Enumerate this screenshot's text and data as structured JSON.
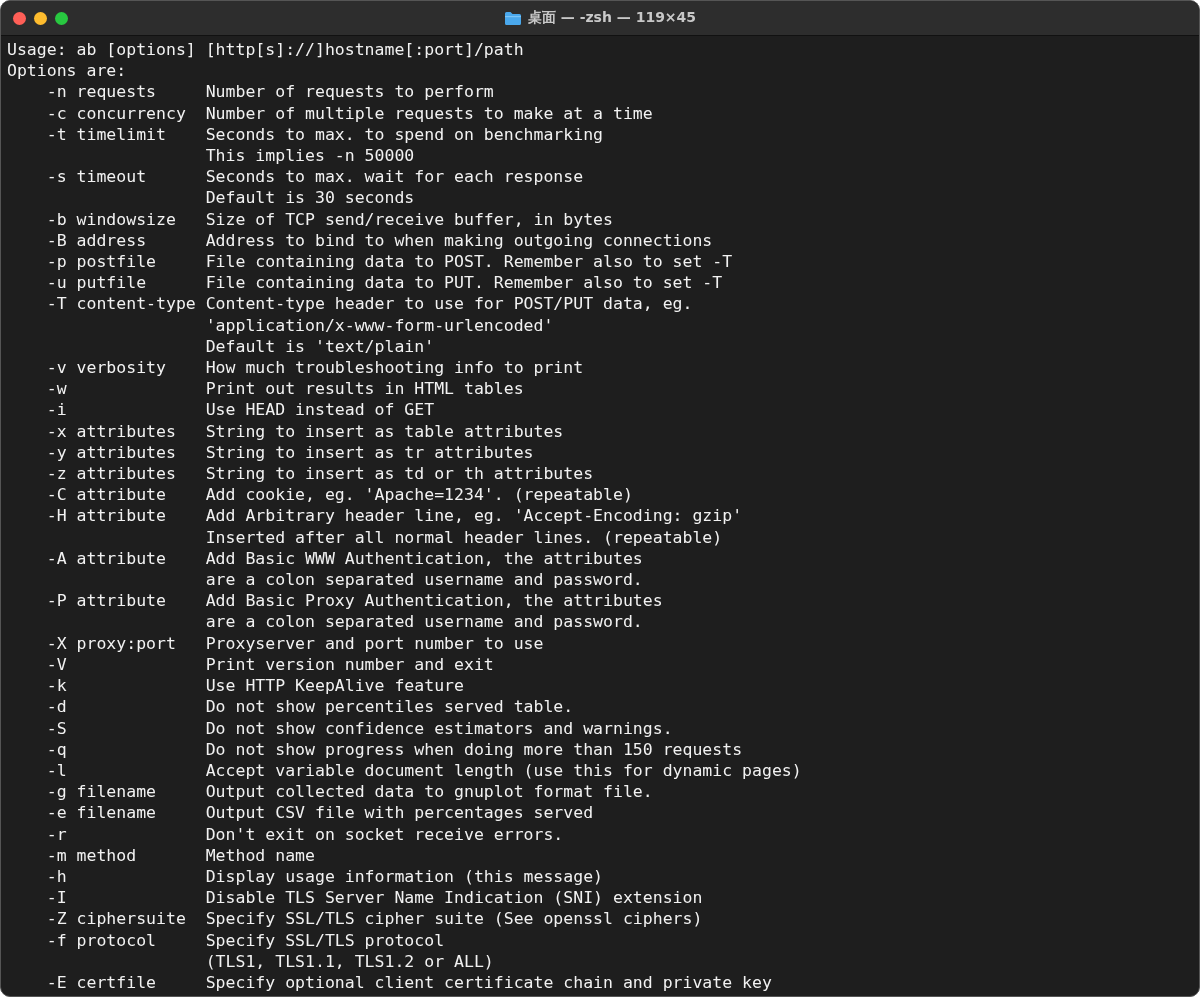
{
  "window": {
    "title": "桌面 — -zsh — 119×45"
  },
  "lines": [
    "Usage: ab [options] [http[s]://]hostname[:port]/path",
    "Options are:",
    "    -n requests     Number of requests to perform",
    "    -c concurrency  Number of multiple requests to make at a time",
    "    -t timelimit    Seconds to max. to spend on benchmarking",
    "                    This implies -n 50000",
    "    -s timeout      Seconds to max. wait for each response",
    "                    Default is 30 seconds",
    "    -b windowsize   Size of TCP send/receive buffer, in bytes",
    "    -B address      Address to bind to when making outgoing connections",
    "    -p postfile     File containing data to POST. Remember also to set -T",
    "    -u putfile      File containing data to PUT. Remember also to set -T",
    "    -T content-type Content-type header to use for POST/PUT data, eg.",
    "                    'application/x-www-form-urlencoded'",
    "                    Default is 'text/plain'",
    "    -v verbosity    How much troubleshooting info to print",
    "    -w              Print out results in HTML tables",
    "    -i              Use HEAD instead of GET",
    "    -x attributes   String to insert as table attributes",
    "    -y attributes   String to insert as tr attributes",
    "    -z attributes   String to insert as td or th attributes",
    "    -C attribute    Add cookie, eg. 'Apache=1234'. (repeatable)",
    "    -H attribute    Add Arbitrary header line, eg. 'Accept-Encoding: gzip'",
    "                    Inserted after all normal header lines. (repeatable)",
    "    -A attribute    Add Basic WWW Authentication, the attributes",
    "                    are a colon separated username and password.",
    "    -P attribute    Add Basic Proxy Authentication, the attributes",
    "                    are a colon separated username and password.",
    "    -X proxy:port   Proxyserver and port number to use",
    "    -V              Print version number and exit",
    "    -k              Use HTTP KeepAlive feature",
    "    -d              Do not show percentiles served table.",
    "    -S              Do not show confidence estimators and warnings.",
    "    -q              Do not show progress when doing more than 150 requests",
    "    -l              Accept variable document length (use this for dynamic pages)",
    "    -g filename     Output collected data to gnuplot format file.",
    "    -e filename     Output CSV file with percentages served",
    "    -r              Don't exit on socket receive errors.",
    "    -m method       Method name",
    "    -h              Display usage information (this message)",
    "    -I              Disable TLS Server Name Indication (SNI) extension",
    "    -Z ciphersuite  Specify SSL/TLS cipher suite (See openssl ciphers)",
    "    -f protocol     Specify SSL/TLS protocol",
    "                    (TLS1, TLS1.1, TLS1.2 or ALL)",
    "    -E certfile     Specify optional client certificate chain and private key"
  ]
}
